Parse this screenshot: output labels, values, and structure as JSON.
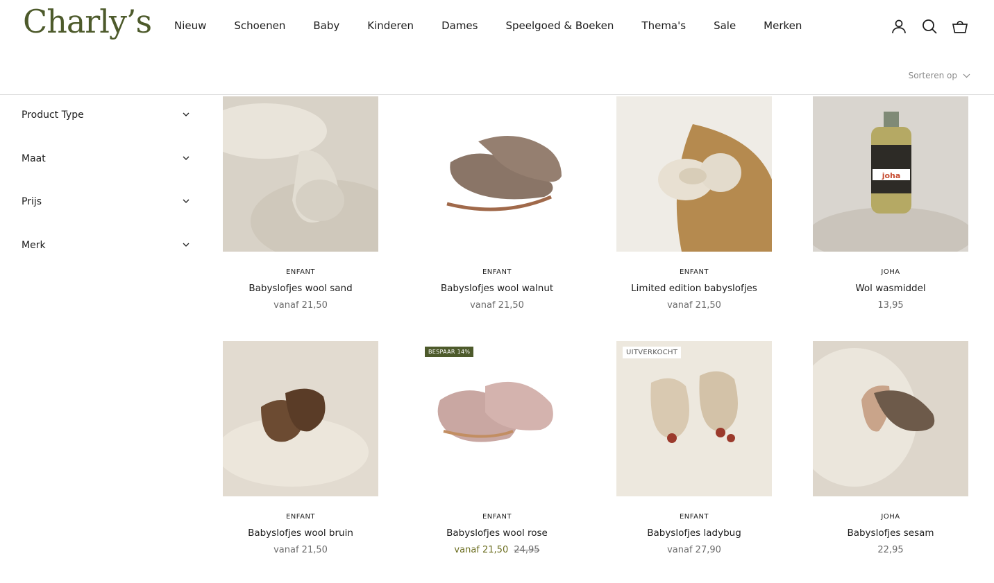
{
  "header": {
    "logo": "Charly’s",
    "nav": [
      "Nieuw",
      "Schoenen",
      "Baby",
      "Kinderen",
      "Dames",
      "Speelgoed & Boeken",
      "Thema's",
      "Sale",
      "Merken"
    ],
    "sort_label": "Sorteren op"
  },
  "filters": [
    "Product Type",
    "Maat",
    "Prijs",
    "Merk"
  ],
  "products": [
    {
      "brand": "ENFANT",
      "title": "Babyslofjes wool sand",
      "price": "vanaf 21,50"
    },
    {
      "brand": "ENFANT",
      "title": "Babyslofjes wool walnut",
      "price": "vanaf 21,50"
    },
    {
      "brand": "ENFANT",
      "title": "Limited edition babyslofjes",
      "price": "vanaf 21,50"
    },
    {
      "brand": "JOHA",
      "title": "Wol wasmiddel",
      "price": "13,95"
    },
    {
      "brand": "ENFANT",
      "title": "Babyslofjes wool bruin",
      "price": "vanaf 21,50"
    },
    {
      "brand": "ENFANT",
      "title": "Babyslofjes wool rose",
      "price": "vanaf 21,50",
      "compare_price": "24,95",
      "badge": "BESPAAR 14%"
    },
    {
      "brand": "ENFANT",
      "title": "Babyslofjes ladybug",
      "price": "vanaf 27,90",
      "badge": "UITVERKOCHT"
    },
    {
      "brand": "JOHA",
      "title": "Babyslofjes sesam",
      "price": "22,95"
    }
  ],
  "product_image_labels": {
    "bottle_label": "joha"
  },
  "colors": {
    "brand": "#4d5a2b",
    "sale_price": "#6b6d1f"
  },
  "icons": [
    "account-icon",
    "search-icon",
    "cart-icon",
    "chevron-down-icon"
  ]
}
